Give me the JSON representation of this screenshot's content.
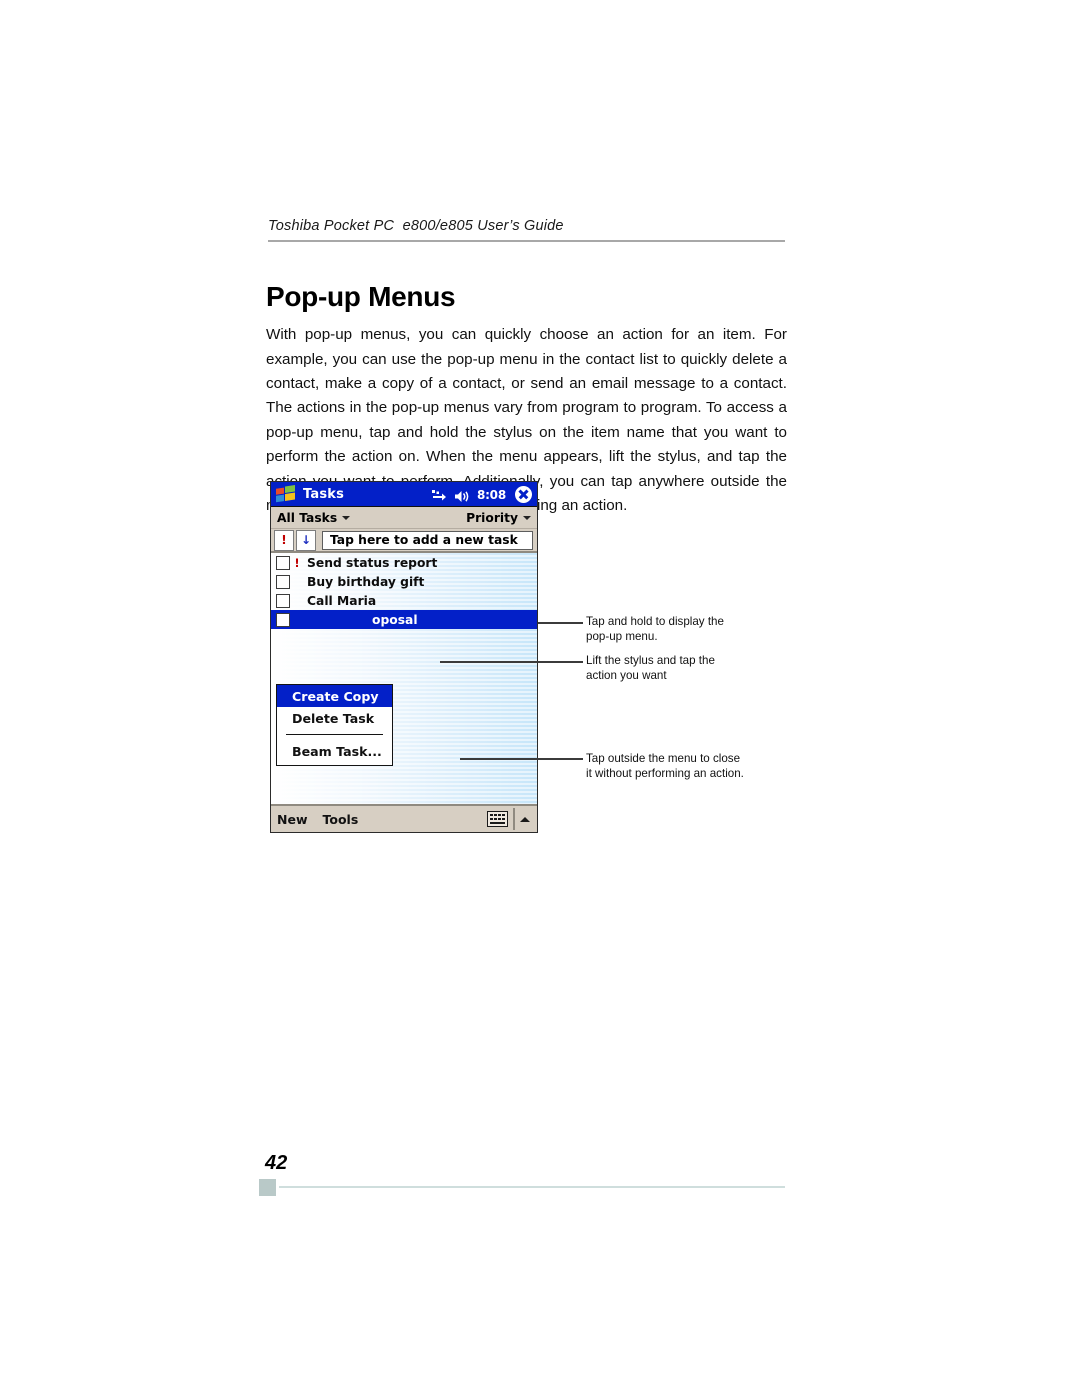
{
  "document": {
    "header": "Toshiba Pocket PC  e800/e805 User’s Guide",
    "title": "Pop-up Menus",
    "body": "With pop-up menus, you can quickly choose an action for an item. For example, you can use the pop-up menu in the contact list to quickly delete a contact, make a copy of a contact, or send an email message to a contact. The actions in the pop-up menus vary from program to program. To access a pop-up menu, tap and hold the stylus on the item name that you want to perform the action on. When the menu appears, lift the stylus, and tap the action you want to perform. Additionally, you can tap anywhere outside the menu to close the menu without performing an action.",
    "page_number": "42"
  },
  "device": {
    "titlebar": {
      "logo_icon": "windows-logo-icon",
      "app_name": "Tasks",
      "sync_icon": "sync-icon",
      "speaker_icon": "speaker-icon",
      "clock": "8:08",
      "close_icon": "close-icon"
    },
    "filterbar": {
      "left_label": "All Tasks",
      "left_caret_icon": "chevron-down-icon",
      "right_label": "Priority",
      "right_caret_icon": "chevron-down-icon"
    },
    "entrybar": {
      "priority_icon": "!",
      "priority_icon_name": "priority-exclamation-icon",
      "sort_icon": "↓",
      "sort_icon_name": "sort-down-arrow-icon",
      "new_task_placeholder": "Tap here to add a new task"
    },
    "tasks": [
      {
        "label": "Send status report",
        "priority": "!",
        "selected": false
      },
      {
        "label": "Buy birthday gift",
        "priority": "",
        "selected": false
      },
      {
        "label": "Call Maria",
        "priority": "",
        "selected": false
      },
      {
        "label": "Complete proposal",
        "visible_label": "oposal",
        "priority": "",
        "selected": true
      }
    ],
    "popup_menu": {
      "items": [
        {
          "label": "Create Copy",
          "highlighted": true
        },
        {
          "label": "Delete Task",
          "highlighted": false
        },
        {
          "label": "Beam Task...",
          "highlighted": false
        }
      ]
    },
    "cmdbar": {
      "new_label": "New",
      "tools_label": "Tools",
      "keyboard_icon": "keyboard-icon",
      "caret_up_icon": "chevron-up-icon"
    },
    "colors": {
      "titlebar": "#0320c8",
      "toolbar": "#d7cfc3",
      "selection": "#0320c8",
      "priority_red": "#c00000",
      "sort_blue": "#2030c0"
    }
  },
  "callouts": [
    {
      "line1": "Tap and hold to display the",
      "line2": "pop-up menu."
    },
    {
      "line1": "Lift the stylus and tap the",
      "line2": "action you want"
    },
    {
      "line1": "Tap outside the menu to close",
      "line2": "it without performing an action."
    }
  ]
}
